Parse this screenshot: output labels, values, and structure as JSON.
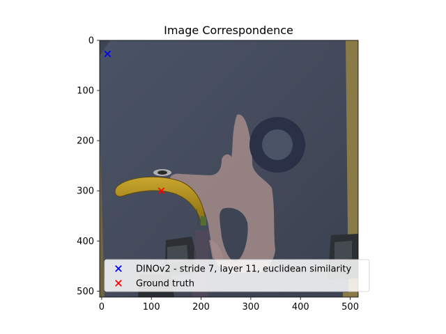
{
  "chart_data": {
    "type": "scatter",
    "title": "Image Correspondence",
    "xlabel": "",
    "ylabel": "",
    "xlim": [
      -4,
      516
    ],
    "ylim": [
      512,
      0
    ],
    "y_inverted": true,
    "xticks": [
      0,
      100,
      200,
      300,
      400,
      500
    ],
    "yticks": [
      0,
      100,
      200,
      300,
      400,
      500
    ],
    "grid": false,
    "legend_position": "lower-right",
    "background_image": "photo: dark blue-gray patterned board with light pink shapes and a dark ring, a yellow banana lying on the left, dark boxy objects near the bottom corners, tan wooden edge on the right",
    "series": [
      {
        "name": "DINOv2 - stride 7, layer 11, euclidean similarity",
        "marker": "x",
        "color": "#0000ff",
        "points": [
          [
            12,
            27
          ]
        ]
      },
      {
        "name": "Ground truth",
        "marker": "x",
        "color": "#ff0000",
        "points": [
          [
            120,
            300
          ]
        ]
      }
    ]
  }
}
